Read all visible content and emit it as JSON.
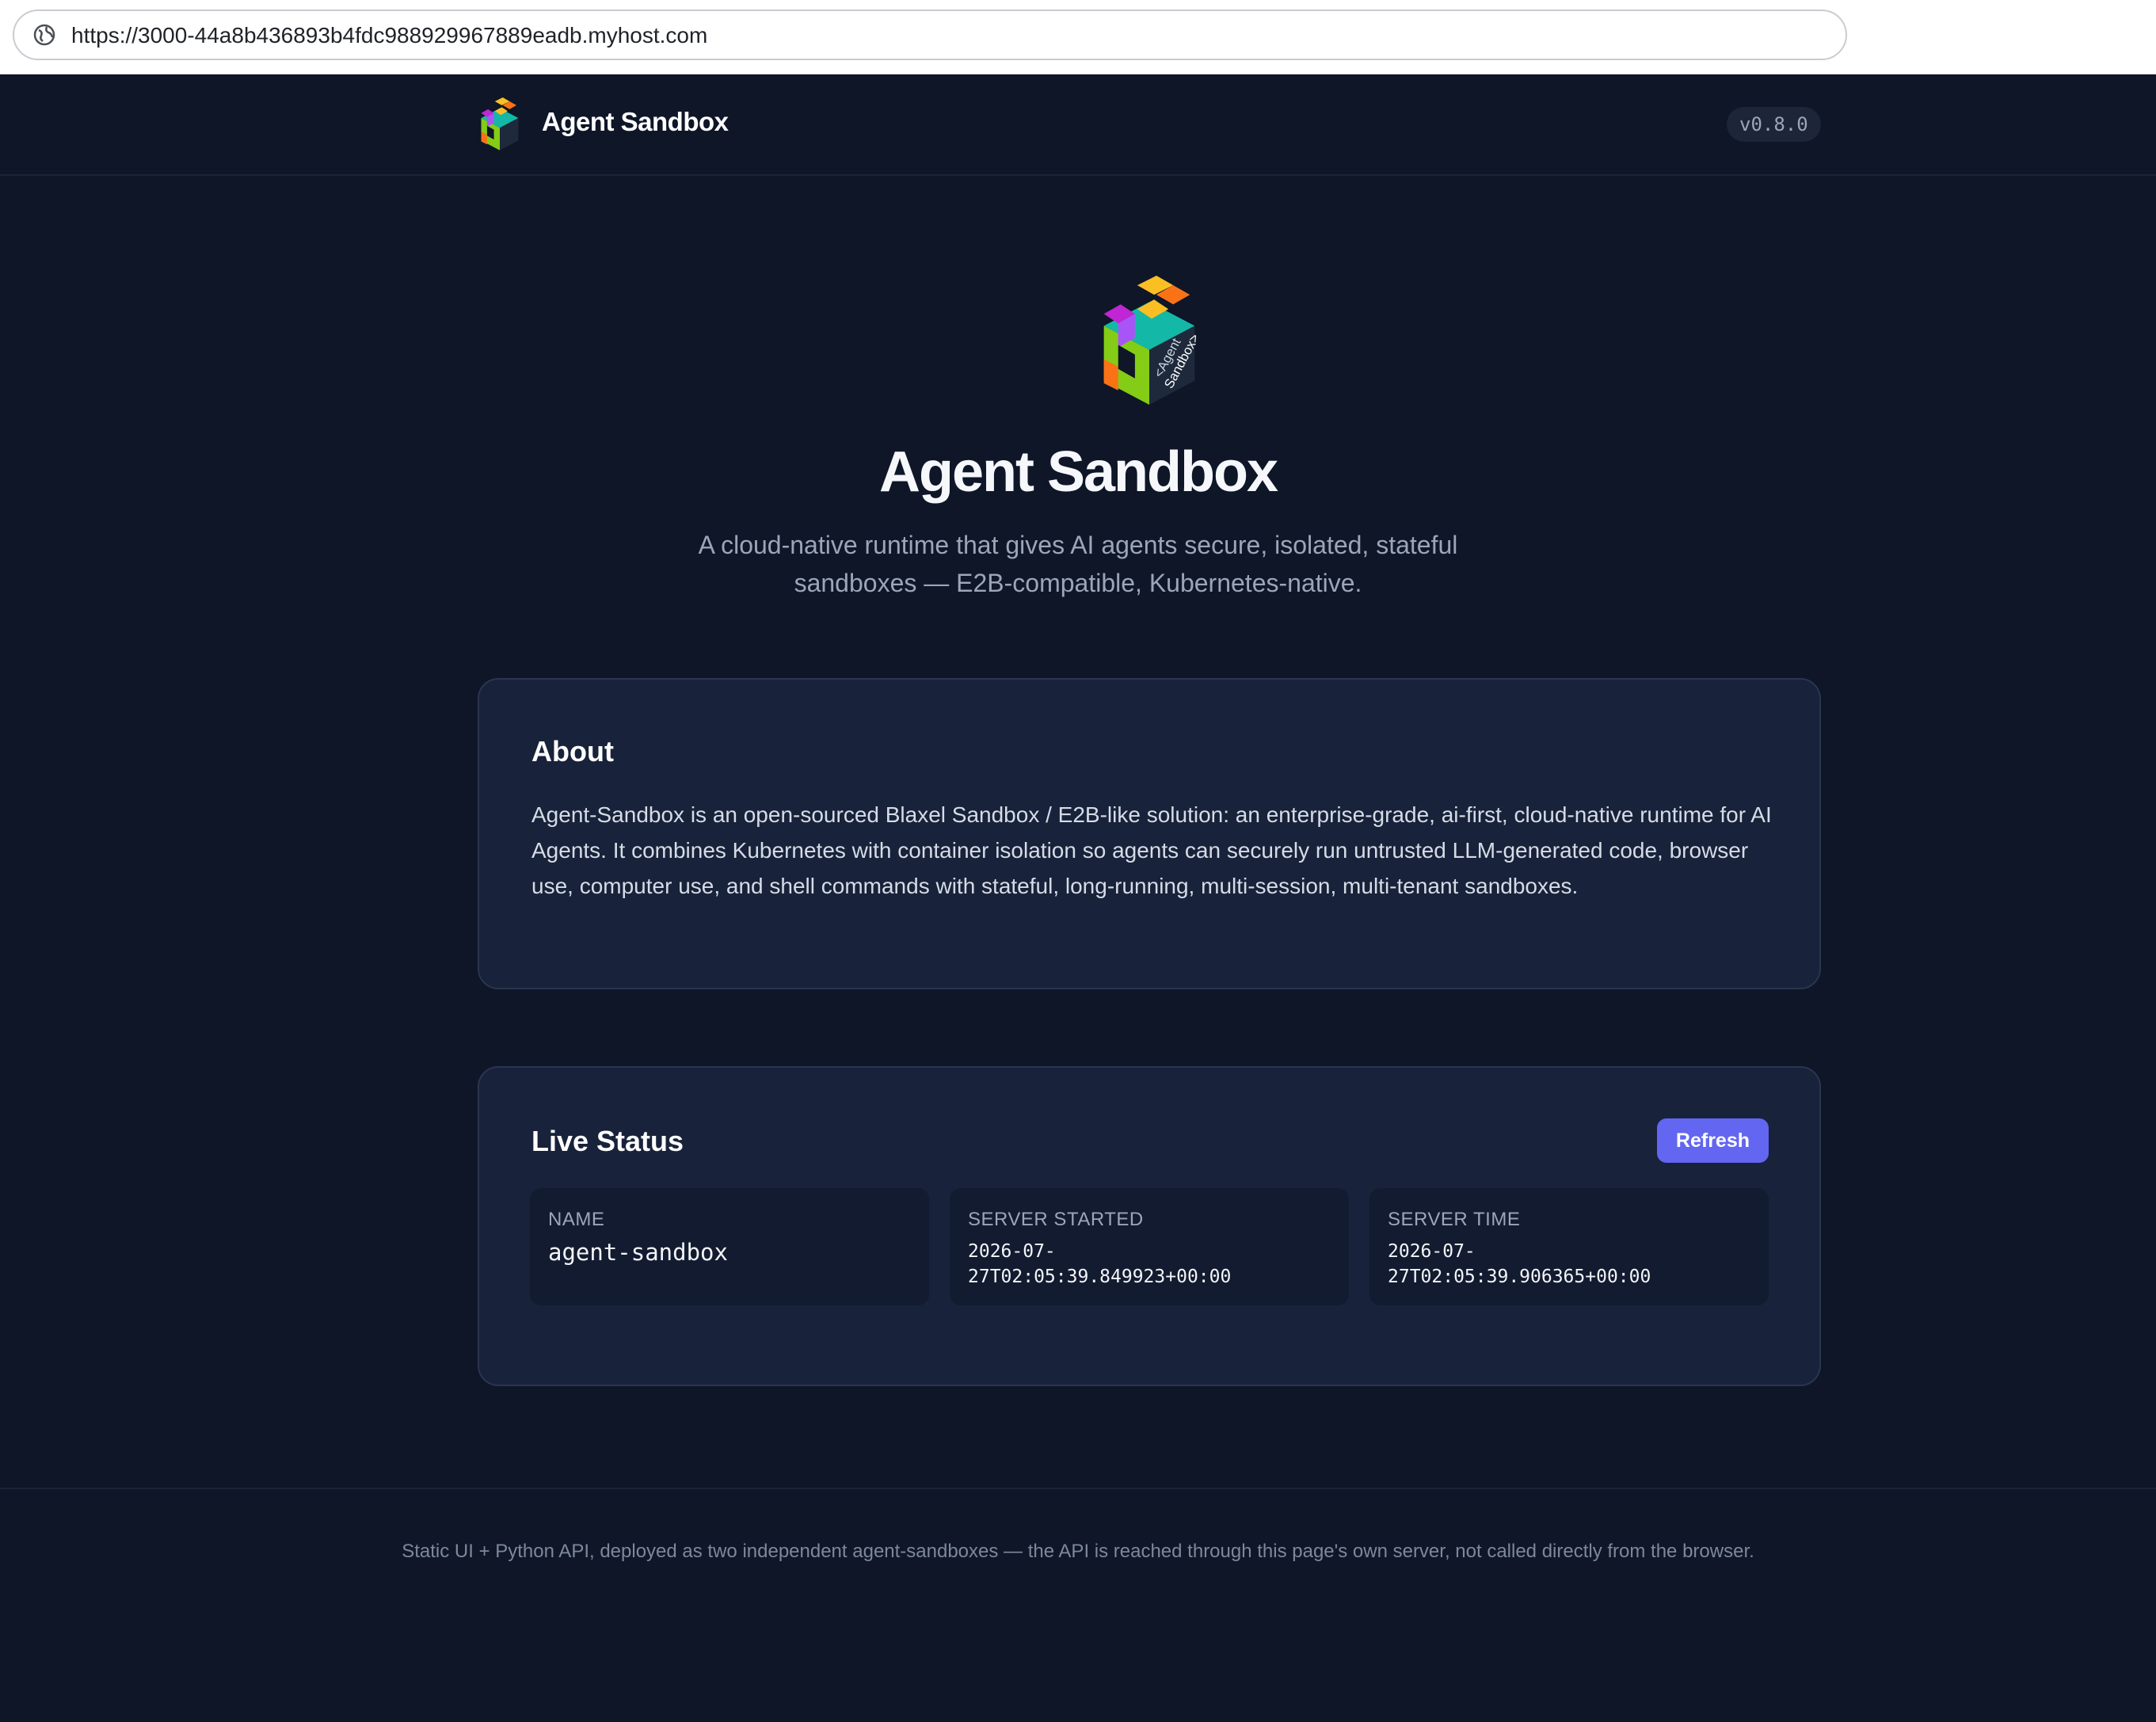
{
  "browser": {
    "url": "https://3000-44a8b436893b4fdc988929967889eadb.myhost.com"
  },
  "header": {
    "brand": "Agent Sandbox",
    "version": "v0.8.0"
  },
  "hero": {
    "title": "Agent Sandbox",
    "subtitle": "A cloud-native runtime that gives AI agents secure, isolated, stateful sandboxes — E2B-compatible, Kubernetes-native."
  },
  "logo": {
    "text_line1": "<Agent",
    "text_line2": "Sandbox>",
    "colors": {
      "top": "#14b8a6",
      "yellow": "#fbbf24",
      "orange": "#f97316",
      "purple": "#c026d3",
      "green": "#84cc16",
      "dark": "#1e293b"
    }
  },
  "about": {
    "title": "About",
    "text": "Agent-Sandbox is an open-sourced Blaxel Sandbox / E2B-like solution: an enterprise-grade, ai-first, cloud-native runtime for AI Agents. It combines Kubernetes with container isolation so agents can securely run untrusted LLM-generated code, browser use, computer use, and shell commands with stateful, long-running, multi-session, multi-tenant sandboxes."
  },
  "status": {
    "title": "Live Status",
    "refresh_label": "Refresh",
    "name_label": "NAME",
    "name_value": "agent-sandbox",
    "started_label": "SERVER STARTED",
    "started_value": "2026-07-27T02:05:39.849923+00:00",
    "time_label": "SERVER TIME",
    "time_value": "2026-07-27T02:05:39.906365+00:00"
  },
  "footer": {
    "text": "Static UI + Python API, deployed as two independent agent-sandboxes — the API is reached through this page's own server, not called directly from the browser."
  },
  "colors": {
    "background": "#0e1628",
    "card": "#18223a",
    "accent": "#6366f1"
  }
}
